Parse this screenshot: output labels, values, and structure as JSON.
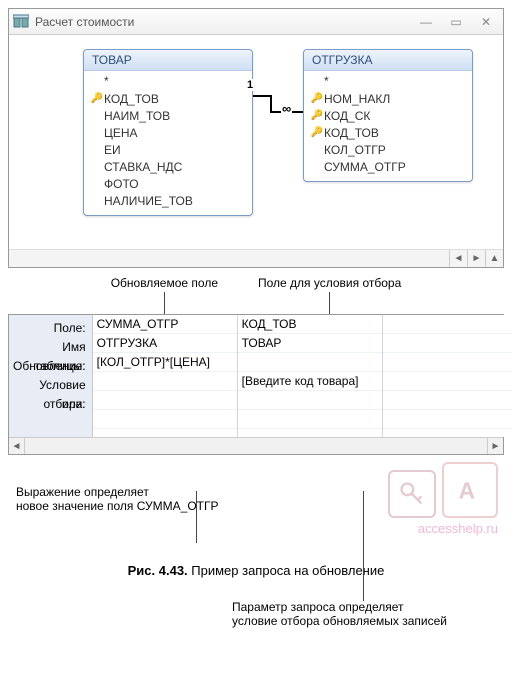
{
  "window": {
    "title": "Расчет стоимости"
  },
  "tables": {
    "t1": {
      "name": "ТОВАР",
      "fields": [
        {
          "label": "КОД_ТОВ",
          "key": true
        },
        {
          "label": "НАИМ_ТОВ",
          "key": false
        },
        {
          "label": "ЦЕНА",
          "key": false
        },
        {
          "label": "ЕИ",
          "key": false
        },
        {
          "label": "СТАВКА_НДС",
          "key": false
        },
        {
          "label": "ФОТО",
          "key": false
        },
        {
          "label": "НАЛИЧИЕ_ТОВ",
          "key": false
        }
      ]
    },
    "t2": {
      "name": "ОТГРУЗКА",
      "fields": [
        {
          "label": "НОМ_НАКЛ",
          "key": true
        },
        {
          "label": "КОД_СК",
          "key": true
        },
        {
          "label": "КОД_ТОВ",
          "key": true
        },
        {
          "label": "КОЛ_ОТГР",
          "key": false
        },
        {
          "label": "СУММА_ОТГР",
          "key": false
        }
      ]
    }
  },
  "relation": {
    "left": "1",
    "right": "∞"
  },
  "anno_top": {
    "left": "Обновляемое поле",
    "right": "Поле для условия отбора"
  },
  "grid": {
    "labels": {
      "field": "Поле:",
      "table": "Имя таблицы:",
      "update": "Обновление:",
      "criteria": "Условие отбора:",
      "or": "или:"
    },
    "cols": [
      {
        "field": "СУММА_ОТГР",
        "table": "ОТГРУЗКА",
        "update": "[КОЛ_ОТГР]*[ЦЕНА]",
        "criteria": "",
        "or": ""
      },
      {
        "field": "КОД_ТОВ",
        "table": "ТОВАР",
        "update": "",
        "criteria": "[Введите код товара]",
        "or": ""
      }
    ]
  },
  "anno_bottom": {
    "left_l1": "Выражение определяет",
    "left_l2": "новое значение поля СУММА_ОТГР",
    "right_l1": "Параметр запроса определяет",
    "right_l2": "условие отбора обновляемых записей"
  },
  "watermark": "accesshelp.ru",
  "caption": {
    "num": "Рис. 4.43.",
    "text": " Пример запроса на обновление"
  }
}
